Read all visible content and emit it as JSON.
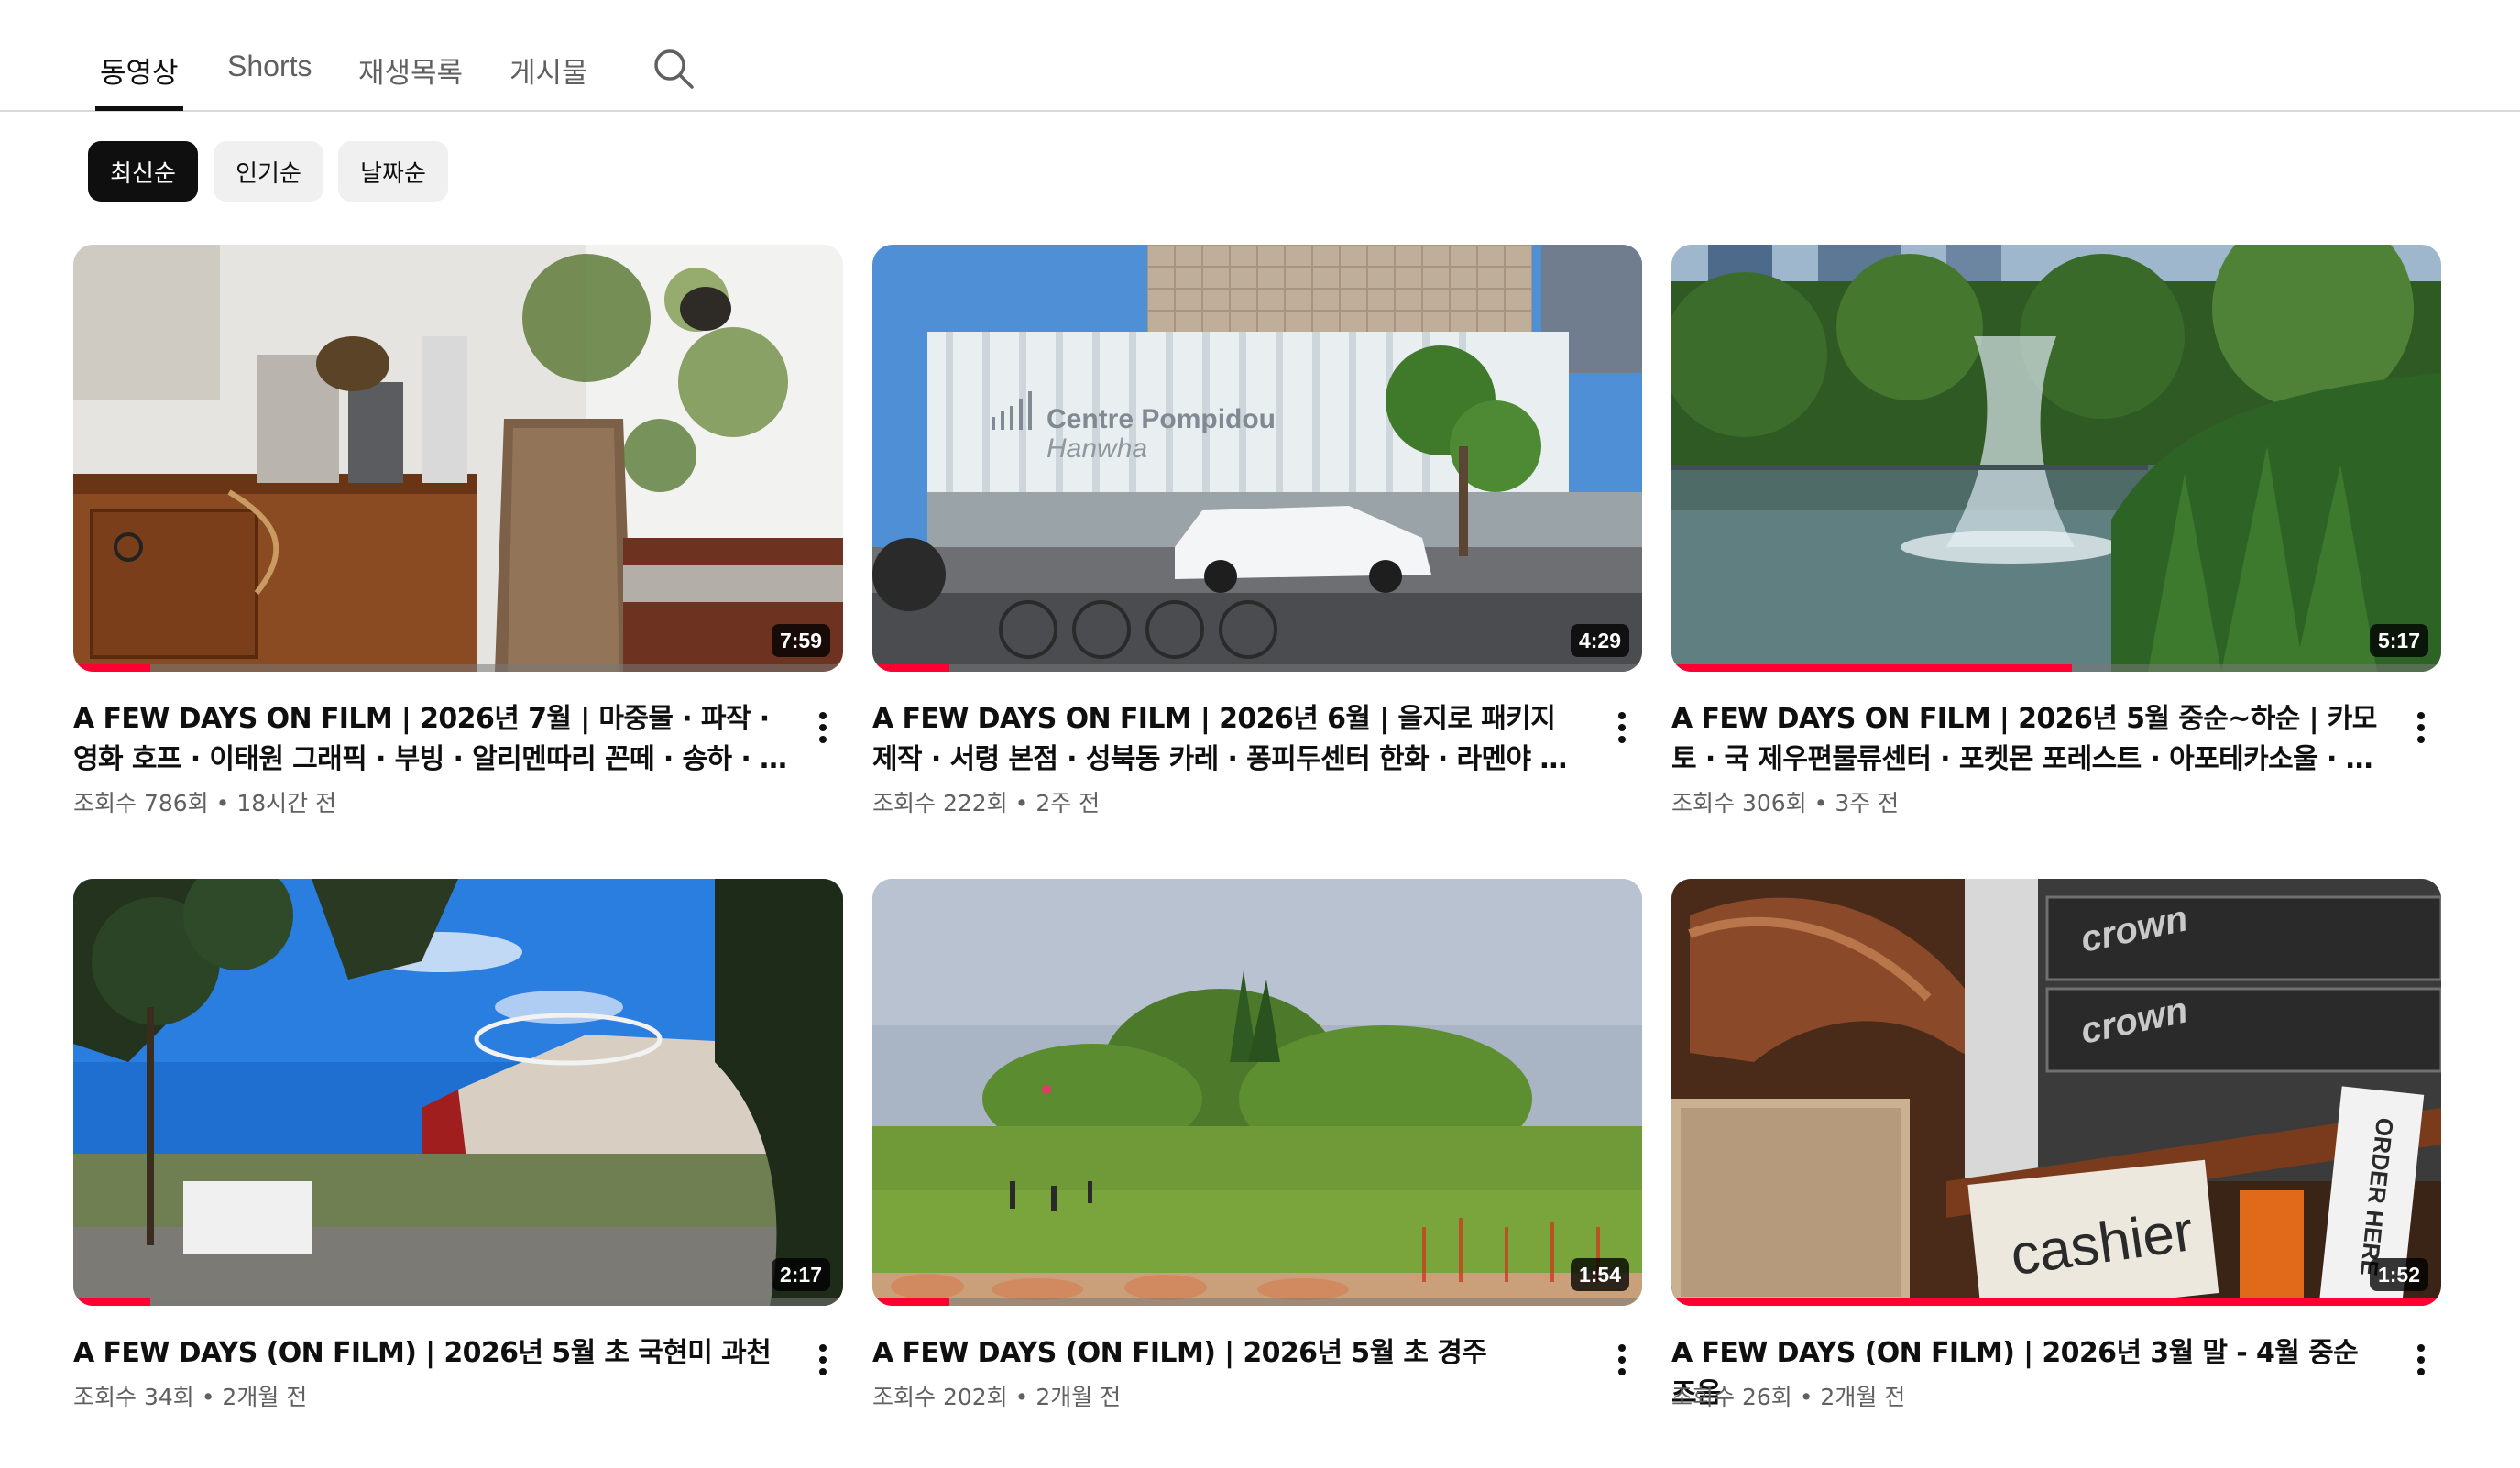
{
  "tabs": [
    {
      "label": "동영상",
      "active": true
    },
    {
      "label": "Shorts",
      "active": false
    },
    {
      "label": "재생목록",
      "active": false
    },
    {
      "label": "게시물",
      "active": false
    }
  ],
  "search_icon": "search-icon",
  "chips": [
    {
      "label": "최신순",
      "active": true
    },
    {
      "label": "인기순",
      "active": false
    },
    {
      "label": "날짜순",
      "active": false
    }
  ],
  "videos": [
    {
      "title": "A FEW DAYS ON FILM | 2026년 7월 | 마중물 · 파작 · 영화 호프 · 이태원 그래픽 · 부빙 · 알리멘따리 꼰떼 · 송하 · 원유니...",
      "views": "조회수 786회",
      "age": "18시간 전",
      "duration": "7:59",
      "watched": 0.1
    },
    {
      "title": "A FEW DAYS ON FILM | 2026년 6월 | 을지로 패키지 제작 · 서령 본점 · 성북동 카레 · 퐁피두센터 한화 · 라멘야 시마",
      "views": "조회수 222회",
      "age": "2주 전",
      "duration": "4:29",
      "watched": 0.1
    },
    {
      "title": "A FEW DAYS ON FILM | 2026년 5월 중순~하순 | 카모토 · 국 제우편물류센터 · 포켓몬 포레스트 · 아포테카소울 · 유영국 작...",
      "views": "조회수 306회",
      "age": "3주 전",
      "duration": "5:17",
      "watched": 0.52
    },
    {
      "title": "A FEW DAYS (ON FILM) | 2026년 5월 초 국현미 과천",
      "views": "조회수 34회",
      "age": "2개월 전",
      "duration": "2:17",
      "watched": 0.1
    },
    {
      "title": "A FEW DAYS (ON FILM) | 2026년 5월 초 경주",
      "views": "조회수 202회",
      "age": "2개월 전",
      "duration": "1:54",
      "watched": 0.1
    },
    {
      "title": "A FEW DAYS (ON FILM) | 2026년 3월 말 - 4월 중순 즈음",
      "views": "조회수 26회",
      "age": "2개월 전",
      "duration": "1:52",
      "watched": 1.0
    }
  ],
  "thumbnail_text": [
    "Centre Pompidou",
    "Hanwha",
    "crown",
    "crown",
    "cashier",
    "ORDER HERE"
  ],
  "colors": {
    "accent": "#ff0033",
    "chip_active": "#0f0f0f",
    "chip_bg": "#f0f0f0",
    "muted_text": "#606060"
  }
}
